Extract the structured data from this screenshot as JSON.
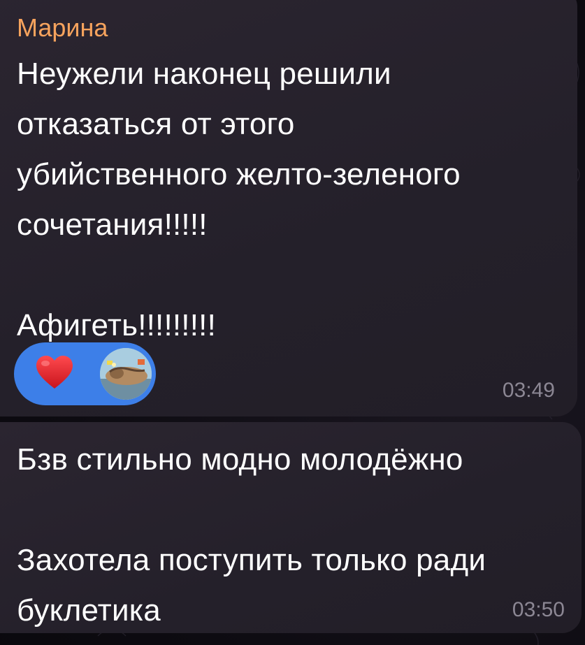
{
  "messages": [
    {
      "sender": "Марина",
      "text": "Неужели наконец решили\nотказаться от этого\nубийственного желто-зеленого\nсочетания!!!!!\n\nАфигеть!!!!!!!!!",
      "time": "03:49",
      "reactions": [
        {
          "icon": "heart-icon",
          "color": "#e0242d"
        },
        {
          "icon": "reactor-avatar",
          "color": "#9fc3d6"
        }
      ]
    },
    {
      "text": "Бзв стильно модно молодёжно\n\nЗахотела поступить только ради\nбуклетика",
      "time": "03:50"
    }
  ],
  "colors": {
    "sender_name": "#f6a35d",
    "bubble": "#27222c",
    "reaction_pill": "#3d7fe8",
    "timestamp": "#8c8794"
  }
}
